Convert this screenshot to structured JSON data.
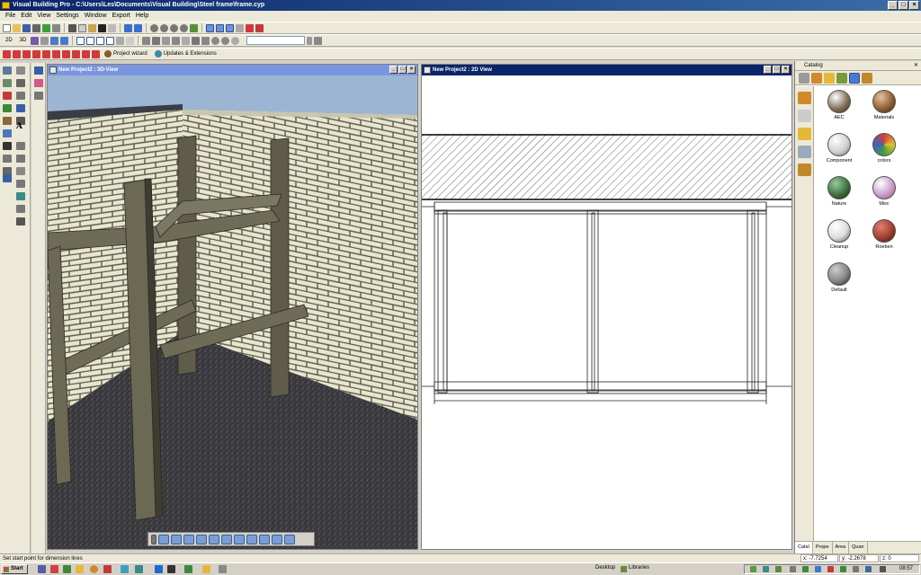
{
  "window": {
    "title": "Visual Building Pro - C:\\Users\\Les\\Documents\\Visual Building\\Steel frame\\frame.cyp"
  },
  "menu": [
    "File",
    "Edit",
    "View",
    "Settings",
    "Window",
    "Export",
    "Help"
  ],
  "toolbar3": {
    "project_wizard": "Project wizard",
    "updates": "Updates & Extensions"
  },
  "toolbar2": {
    "view_2d": "2D",
    "view_3d": "3D"
  },
  "view3d": {
    "title": "New Project2 : 3D-View"
  },
  "view2d": {
    "title": "New Project2 : 2D View"
  },
  "catalog": {
    "title": "Catalog",
    "items": [
      {
        "label": "AEC",
        "color": "#7a6a50"
      },
      {
        "label": "Materials",
        "color": "#8a5a30"
      },
      {
        "label": "Component",
        "color": "#dddddd"
      },
      {
        "label": "colors",
        "color": "#d04040"
      },
      {
        "label": "Nature",
        "color": "#3a6a3a"
      },
      {
        "label": "Misc",
        "color": "#c8a0d0"
      },
      {
        "label": "Cleanup",
        "color": "#f0f0f0"
      },
      {
        "label": "Roeben",
        "color": "#a04030"
      },
      {
        "label": "Default",
        "color": "#888888"
      }
    ],
    "tabs": [
      "Catal",
      "Prope",
      "Area",
      "Quan"
    ]
  },
  "status": {
    "message": "Set start point for dimension lines",
    "x": "x: -7.7254",
    "y": "y: -2.2678",
    "z": "z: 0"
  },
  "taskbar": {
    "start": "Start",
    "desktop": "Desktop",
    "libraries": "Libraries",
    "clock": "08:57"
  }
}
